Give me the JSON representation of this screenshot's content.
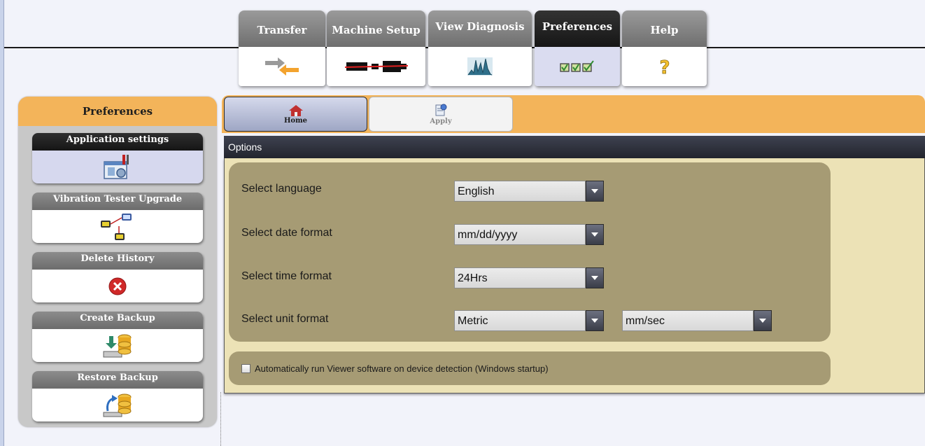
{
  "nav_tabs": [
    {
      "label": "Transfer",
      "icon": "transfer-arrows-icon"
    },
    {
      "label": "Machine Setup",
      "icon": "machine-coupling-icon"
    },
    {
      "label": "View Diagnosis",
      "icon": "spectrum-icon"
    },
    {
      "label": "Preferences",
      "icon": "checkboxes-icon",
      "active": true
    },
    {
      "label": "Help",
      "icon": "question-icon"
    }
  ],
  "left_panel": {
    "title": "Preferences",
    "items": [
      {
        "label": "Application settings",
        "icon": "application-settings-icon",
        "active": true
      },
      {
        "label": "Vibration Tester Upgrade",
        "icon": "tester-upgrade-icon"
      },
      {
        "label": "Delete History",
        "icon": "delete-icon"
      },
      {
        "label": "Create Backup",
        "icon": "create-backup-icon"
      },
      {
        "label": "Restore Backup",
        "icon": "restore-backup-icon"
      }
    ]
  },
  "toolbar": {
    "home_label": "Home",
    "apply_label": "Apply"
  },
  "options": {
    "title": "Options",
    "language_label": "Select language",
    "language_value": "English",
    "date_label": "Select date format",
    "date_value": "mm/dd/yyyy",
    "time_label": "Select time format",
    "time_value": "24Hrs",
    "unit_label": "Select unit format",
    "unit_value": "Metric",
    "unit_sub_value": "mm/sec",
    "startup_label": "Automatically run Viewer software on device detection (Windows startup)",
    "startup_checked": false
  },
  "colors": {
    "accent_orange": "#f3b45a",
    "group_bg": "#a69b74",
    "options_bg": "#ece2b6",
    "dark_header": "#23252e"
  }
}
